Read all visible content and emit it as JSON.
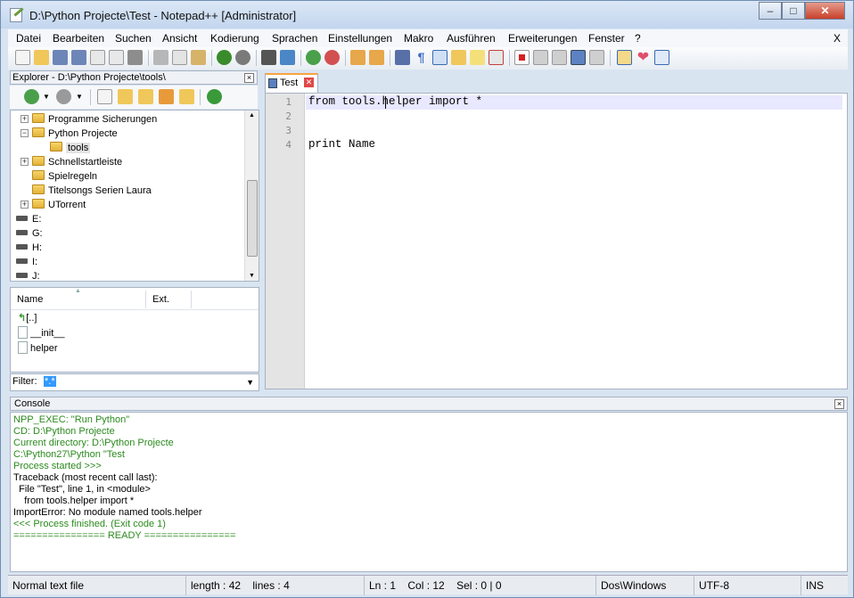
{
  "window": {
    "title": "D:\\Python Projecte\\Test - Notepad++ [Administrator]"
  },
  "menu": [
    "Datei",
    "Bearbeiten",
    "Suchen",
    "Ansicht",
    "Kodierung",
    "Sprachen",
    "Einstellungen",
    "Makro",
    "Ausführen",
    "Erweiterungen",
    "Fenster",
    "?"
  ],
  "menu_close": "X",
  "explorer": {
    "title": "Explorer - D:\\Python Projecte\\tools\\",
    "tree": [
      {
        "label": "Programme Sicherungen",
        "level": 1,
        "type": "folder",
        "expander": "+"
      },
      {
        "label": "Python Projecte",
        "level": 1,
        "type": "folder",
        "expander": "-"
      },
      {
        "label": "tools",
        "level": 2,
        "type": "folder",
        "selected": true
      },
      {
        "label": "Schnellstartleiste",
        "level": 1,
        "type": "folder",
        "expander": "+"
      },
      {
        "label": "Spielregeln",
        "level": 1,
        "type": "folder"
      },
      {
        "label": "Titelsongs Serien Laura",
        "level": 1,
        "type": "folder"
      },
      {
        "label": "UTorrent",
        "level": 1,
        "type": "folder",
        "expander": "+"
      },
      {
        "label": "E:",
        "level": 0,
        "type": "drive"
      },
      {
        "label": "G:",
        "level": 0,
        "type": "drive"
      },
      {
        "label": "H:",
        "level": 0,
        "type": "drive"
      },
      {
        "label": "I:",
        "level": 0,
        "type": "drive"
      },
      {
        "label": "J:",
        "level": 0,
        "type": "drive"
      }
    ],
    "columns": {
      "name": "Name",
      "ext": "Ext."
    },
    "files": [
      "[..]",
      "__init__",
      "helper"
    ],
    "filter_label": "Filter:",
    "filter_value": "*.*"
  },
  "editor": {
    "tab": "Test",
    "lines": [
      "from tools.helper import *",
      "",
      "",
      "print Name"
    ],
    "line_numbers": [
      "1",
      "2",
      "3",
      "4"
    ]
  },
  "console": {
    "title": "Console",
    "lines": [
      {
        "text": "NPP_EXEC: \"Run Python\"",
        "color": "#2b8a1e"
      },
      {
        "text": "CD: D:\\Python Projecte",
        "color": "#2b8a1e"
      },
      {
        "text": "Current directory: D:\\Python Projecte",
        "color": "#2b8a1e"
      },
      {
        "text": "C:\\Python27\\Python \"Test",
        "color": "#2b8a1e"
      },
      {
        "text": "Process started >>>",
        "color": "#2b8a1e"
      },
      {
        "text": "Traceback (most recent call last):",
        "color": "#000000"
      },
      {
        "text": "  File \"Test\", line 1, in <module>",
        "color": "#000000"
      },
      {
        "text": "    from tools.helper import *",
        "color": "#000000"
      },
      {
        "text": "ImportError: No module named tools.helper",
        "color": "#000000"
      },
      {
        "text": "<<< Process finished. (Exit code 1)",
        "color": "#2b8a1e"
      },
      {
        "text": "================ READY ================",
        "color": "#2b8a1e"
      }
    ]
  },
  "status": {
    "type": "Normal text file",
    "length": "length : 42",
    "lines": "lines : 4",
    "ln": "Ln : 1",
    "col": "Col : 12",
    "sel": "Sel : 0 | 0",
    "eol": "Dos\\Windows",
    "encoding": "UTF-8",
    "mode": "INS"
  },
  "colors": {
    "green": "#2b8a1e",
    "accent": "#f6a440"
  }
}
